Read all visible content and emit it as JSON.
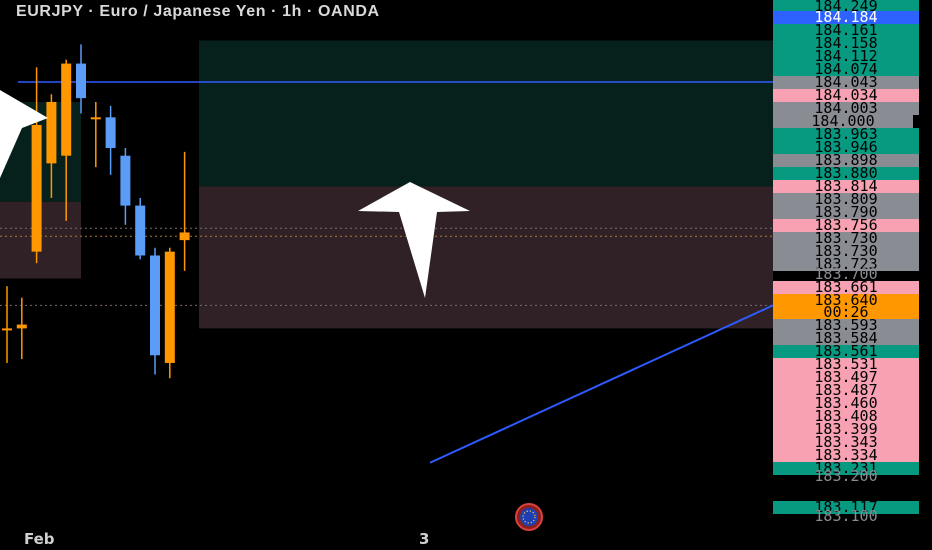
{
  "header": {
    "title": "EURJPY · Euro / Japanese Yen · 1h · OANDA"
  },
  "time_axis": {
    "labels": [
      "Feb",
      "3"
    ]
  },
  "colors": {
    "background": "#000000",
    "bullish_candle": "#ff9800",
    "bearish_candle": "#5b9cf6",
    "demand_zone_fill": "#06201c",
    "supply_zone_fill": "#2f2125",
    "horizontal_line": "#2e5bff",
    "trend_line": "#2e5bff",
    "arrow": "#ffffff",
    "tag_green": "#089981",
    "tag_pink": "#f7a1b3",
    "tag_gray": "#8a8c93",
    "tag_blue": "#2e62ff",
    "tag_orange": "#ff9800"
  },
  "price_tags": [
    {
      "text": "184.249",
      "color": "green"
    },
    {
      "text": "184.184",
      "color": "blue"
    },
    {
      "text": "184.161",
      "color": "green"
    },
    {
      "text": "184.158",
      "color": "green"
    },
    {
      "text": "184.112",
      "color": "green"
    },
    {
      "text": "184.074",
      "color": "green"
    },
    {
      "text": "184.043",
      "color": "gray"
    },
    {
      "text": "184.034",
      "color": "pink"
    },
    {
      "text": "184.003",
      "color": "gray"
    },
    {
      "text": "184.000",
      "color": "gray"
    },
    {
      "text": "183.963",
      "color": "green"
    },
    {
      "text": "183.946",
      "color": "green"
    },
    {
      "text": "183.898",
      "color": "gray"
    },
    {
      "text": "183.880",
      "color": "green"
    },
    {
      "text": "183.814",
      "color": "pink"
    },
    {
      "text": "183.809",
      "color": "gray"
    },
    {
      "text": "183.790",
      "color": "gray"
    },
    {
      "text": "183.756",
      "color": "pink"
    },
    {
      "text": "183.730",
      "color": "gray"
    },
    {
      "text": "183.730",
      "color": "gray"
    },
    {
      "text": "183.723",
      "color": "gray"
    },
    {
      "text": "183.700",
      "color": "gray"
    },
    {
      "text": "183.661",
      "color": "pink"
    },
    {
      "text": "183.640",
      "color": "orange"
    },
    {
      "text": "00:26",
      "color": "orange"
    },
    {
      "text": "183.593",
      "color": "gray"
    },
    {
      "text": "183.584",
      "color": "gray"
    },
    {
      "text": "183.561",
      "color": "green"
    },
    {
      "text": "183.531",
      "color": "pink"
    },
    {
      "text": "183.497",
      "color": "pink"
    },
    {
      "text": "183.487",
      "color": "pink"
    },
    {
      "text": "183.460",
      "color": "pink"
    },
    {
      "text": "183.408",
      "color": "pink"
    },
    {
      "text": "183.399",
      "color": "pink"
    },
    {
      "text": "183.343",
      "color": "pink"
    },
    {
      "text": "183.334",
      "color": "pink"
    },
    {
      "text": "183.231",
      "color": "green"
    },
    {
      "text": "183.200",
      "color": "gray"
    },
    {
      "text": "183.117",
      "color": "green"
    },
    {
      "text": "183.100",
      "color": "gray"
    }
  ],
  "chart_data": {
    "type": "candlestick",
    "title": "EURJPY · Euro / Japanese Yen · 1h · OANDA",
    "y_unit": "JPY",
    "ylim": [
      183.0,
      184.3
    ],
    "x_tick_labels": [
      "Feb",
      "3"
    ],
    "candles": [
      {
        "o": 183.4,
        "h": 183.51,
        "l": 183.31,
        "c": 183.4
      },
      {
        "o": 183.4,
        "h": 183.48,
        "l": 183.32,
        "c": 183.41
      },
      {
        "o": 183.6,
        "h": 184.08,
        "l": 183.57,
        "c": 183.93
      },
      {
        "o": 183.83,
        "h": 184.01,
        "l": 183.74,
        "c": 183.99
      },
      {
        "o": 183.85,
        "h": 184.1,
        "l": 183.68,
        "c": 184.09
      },
      {
        "o": 184.09,
        "h": 184.14,
        "l": 183.96,
        "c": 184.0
      },
      {
        "o": 183.95,
        "h": 183.99,
        "l": 183.82,
        "c": 183.95
      },
      {
        "o": 183.95,
        "h": 183.98,
        "l": 183.8,
        "c": 183.87
      },
      {
        "o": 183.85,
        "h": 183.87,
        "l": 183.67,
        "c": 183.72
      },
      {
        "o": 183.72,
        "h": 183.74,
        "l": 183.58,
        "c": 183.59
      },
      {
        "o": 183.59,
        "h": 183.61,
        "l": 183.28,
        "c": 183.33
      },
      {
        "o": 183.31,
        "h": 183.61,
        "l": 183.27,
        "c": 183.6
      },
      {
        "o": 183.63,
        "h": 183.86,
        "l": 183.55,
        "c": 183.65
      }
    ],
    "zones": [
      {
        "name": "demand",
        "low": 183.73,
        "high": 183.99
      },
      {
        "name": "supply",
        "low": 183.53,
        "high": 183.73
      },
      {
        "name": "demand",
        "low": 183.77,
        "high": 184.15
      },
      {
        "name": "supply",
        "low": 183.4,
        "high": 183.77
      }
    ],
    "horizontal_lines": [
      {
        "price": 184.042,
        "style": "solid"
      },
      {
        "price": 183.661,
        "style": "dotted"
      },
      {
        "price": 183.64,
        "style": "dotted"
      },
      {
        "price": 183.46,
        "style": "dotted"
      }
    ],
    "trend_line": {
      "from_price": 183.05,
      "to_price": 183.46
    },
    "arrows": [
      {
        "direction": "up"
      },
      {
        "direction": "down-right"
      }
    ],
    "current_price": 183.64,
    "countdown": "00:26"
  }
}
